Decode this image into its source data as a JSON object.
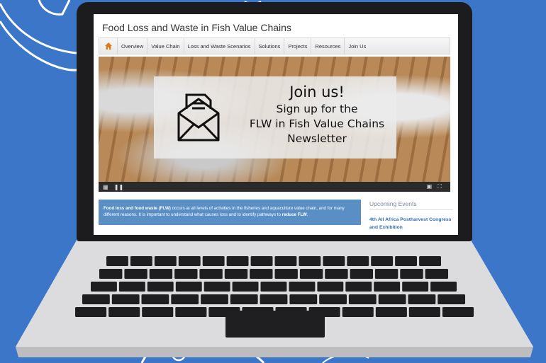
{
  "site": {
    "title": "Food Loss and Waste in Fish Value Chains"
  },
  "nav": {
    "home_icon": "home-icon",
    "items": [
      "Overview",
      "Value Chain",
      "Loss and Waste Scenarios",
      "Solutions",
      "Projects",
      "Resources",
      "Join Us"
    ]
  },
  "hero": {
    "line1": "Join us!",
    "line2": "Sign up for the",
    "line3": "FLW in Fish Value Chains",
    "line4": "Newsletter",
    "icon": "envelope-newsletter-icon"
  },
  "player": {
    "controls": [
      "grid-icon",
      "pause-icon",
      "pip-icon",
      "fullscreen-icon"
    ]
  },
  "intro": {
    "bold1": "Food loss and food waste (FLW)",
    "text1": " occurs at all levels of activities in the fisheries and aquaculture value chain, and for many different reasons. It is important to understand what causes loss and to identify pathways to ",
    "bold2": "reduce FLW",
    "text2": "."
  },
  "events": {
    "title": "Upcoming Events",
    "link": "4th All Africa Postharvest Congress and Exhibition"
  },
  "colors": {
    "background": "#3b76c9",
    "accent": "#5a8fc6",
    "home": "#e07a1c",
    "link": "#2f6db5"
  }
}
